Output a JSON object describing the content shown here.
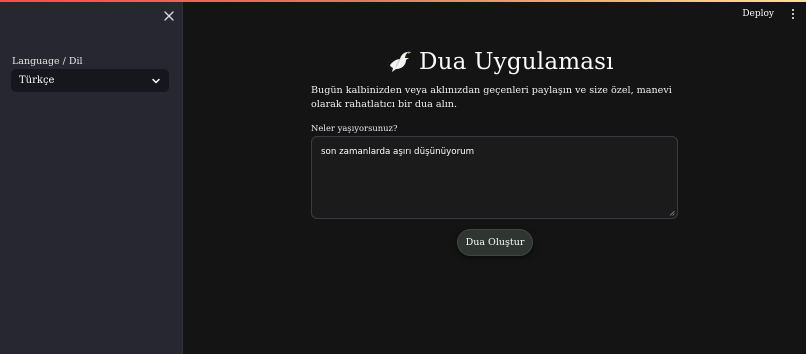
{
  "sidebar": {
    "close_icon": "close-icon",
    "language_label": "Language / Dil",
    "language_selected": "Türkçe",
    "chevron_icon": "chevron-down-icon"
  },
  "header": {
    "deploy_label": "Deploy",
    "menu_icon": "kebab-menu-icon"
  },
  "main": {
    "title_icon": "dove-icon",
    "title": "Dua Uygulaması",
    "intro": "Bugün kalbinizden veya aklınızdan geçenleri paylaşın ve size özel, manevi olarak rahatlatıcı bir dua alın.",
    "input_label": "Neler yaşıyorsunuz?",
    "input_value": "son zamanlarda aşırı düşünüyorum",
    "submit_label": "Dua Oluştur"
  },
  "colors": {
    "background": "#141414",
    "sidebar": "#262730",
    "select_bg": "#16171d",
    "button_bg": "#2f3530",
    "accent_stripe_start": "#ff4b4b",
    "accent_stripe_end": "#ffe38a"
  }
}
